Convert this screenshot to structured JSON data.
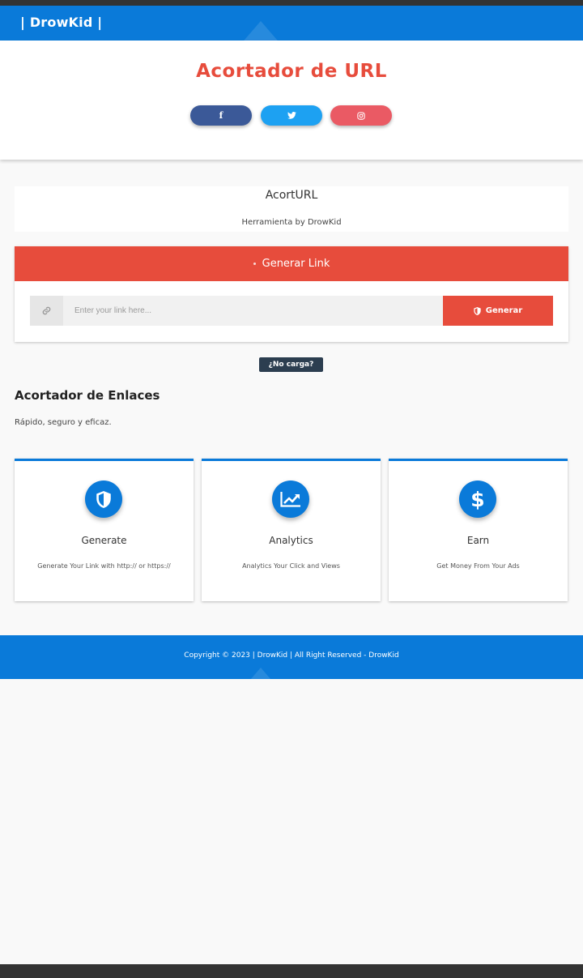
{
  "navbar": {
    "brand": "| DrowKid |"
  },
  "header": {
    "title": "Acortador de URL",
    "social": [
      {
        "network": "facebook",
        "icon": "f"
      },
      {
        "network": "twitter",
        "icon": "twitter-bird"
      },
      {
        "network": "instagram",
        "icon": "instagram-camera"
      }
    ]
  },
  "tool": {
    "name": "AcortURL",
    "byline": "Herramienta by DrowKid"
  },
  "generator": {
    "heading": "Generar Link",
    "input_placeholder": "Enter your link here...",
    "button_label": "Generar"
  },
  "no_carga": "¿No carga?",
  "section": {
    "title": "Acortador de Enlaces",
    "subtitle": "Rápido, seguro y eficaz."
  },
  "features": [
    {
      "icon": "shield-icon",
      "title": "Generate",
      "desc": "Generate Your Link with http:// or https://"
    },
    {
      "icon": "chart-line-icon",
      "title": "Analytics",
      "desc": "Analytics Your Click and Views"
    },
    {
      "icon": "dollar-icon",
      "title": "Earn",
      "desc": "Get Money From Your Ads"
    }
  ],
  "footer": {
    "copyright": "Copyright © 2023 | DrowKid | All Right Reserved - DrowKid"
  },
  "colors": {
    "primary": "#0a7ad9",
    "accent_red": "#e74c3c",
    "dark": "#2c3e50",
    "facebook": "#3b5998",
    "twitter": "#1da1f2",
    "instagram": "#ea5a64"
  }
}
